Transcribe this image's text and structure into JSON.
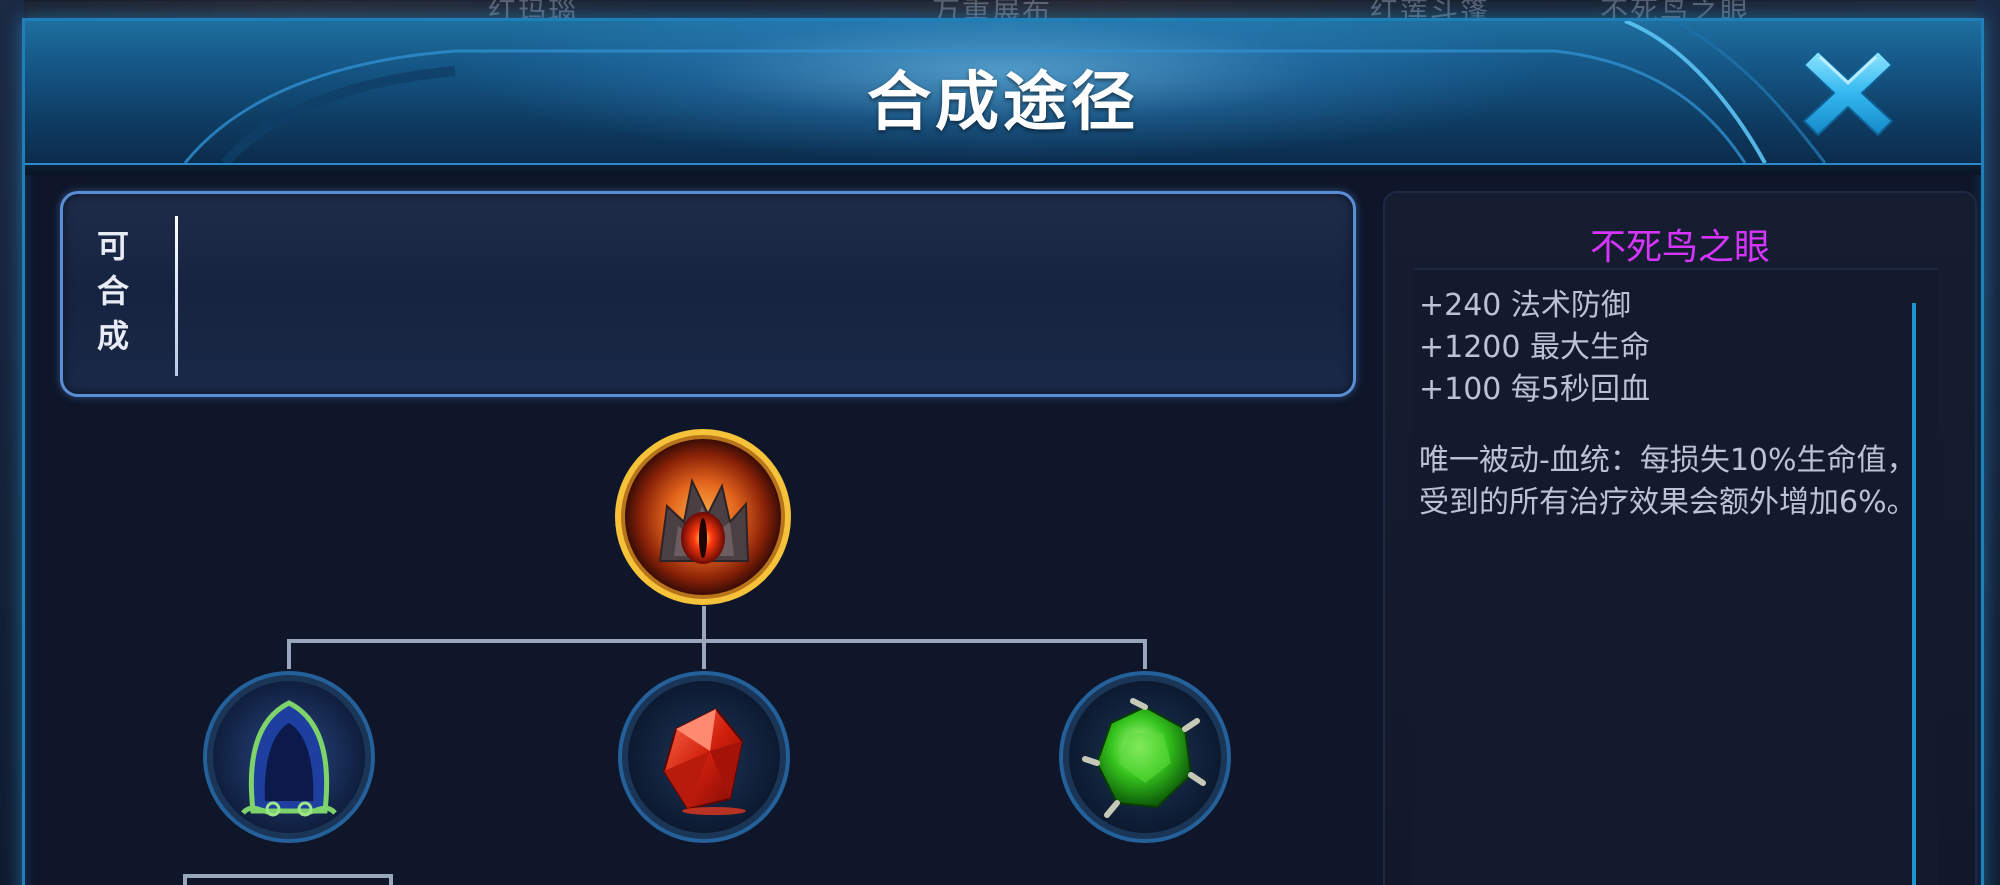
{
  "background": {
    "top_texts": [
      "红玛瑙",
      "万重展布",
      "红莲斗篷",
      "不死鸟之眼"
    ]
  },
  "modal": {
    "title": "合成途径",
    "close_icon": "close-x-icon"
  },
  "combine_panel": {
    "label_chars": [
      "可",
      "合",
      "成"
    ]
  },
  "tree": {
    "root": {
      "icon": "burning-eye-item-icon"
    },
    "children": [
      {
        "icon": "green-hood-cloak-item-icon"
      },
      {
        "icon": "red-crystal-item-icon"
      },
      {
        "icon": "green-gem-item-icon"
      }
    ]
  },
  "description": {
    "item_name": "不死鸟之眼",
    "stats": [
      "+240 法术防御",
      "+1200 最大生命",
      "+100 每5秒回血"
    ],
    "passive": "唯一被动-血统：每损失10%生命值，受到的所有治疗效果会额外增加6%。"
  },
  "colors": {
    "accent_blue": "#1f7fb8",
    "item_name_purple": "#d735ff",
    "root_ring_gold": "#f6c23a"
  }
}
